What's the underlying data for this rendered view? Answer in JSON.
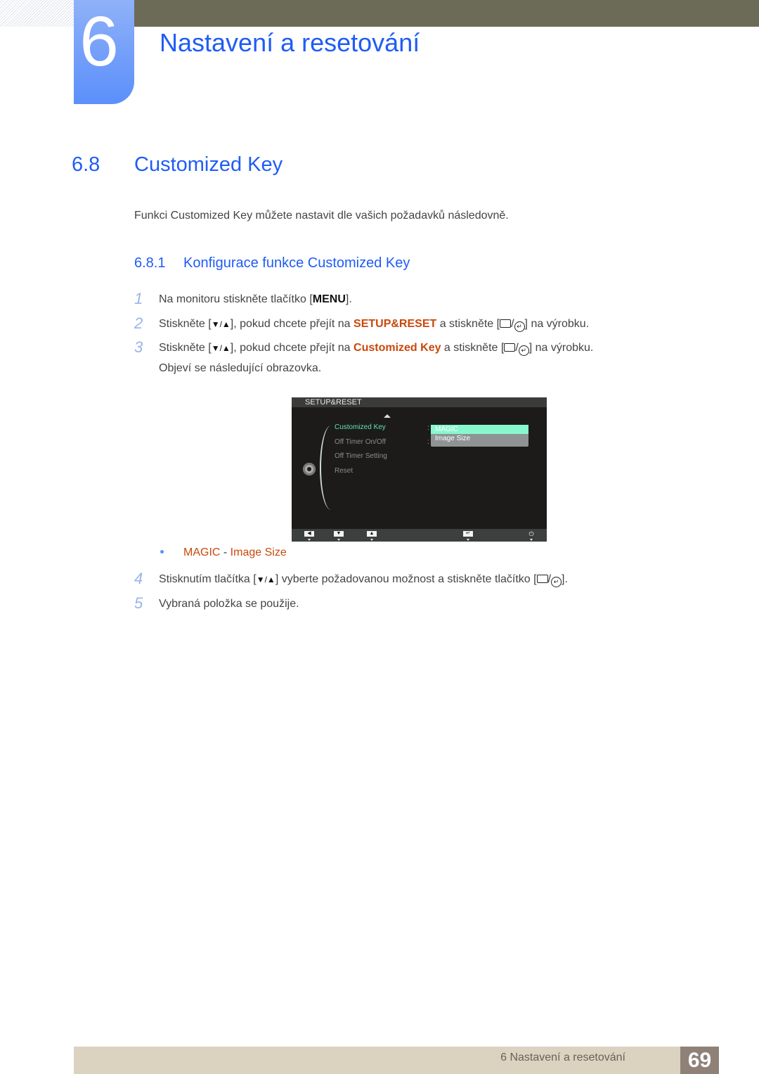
{
  "chapter": {
    "number": "6",
    "title": "Nastavení a resetování"
  },
  "section": {
    "number": "6.8",
    "title": "Customized Key"
  },
  "intro": "Funkci Customized Key můžete nastavit dle vašich požadavků následovně.",
  "subsection": {
    "number": "6.8.1",
    "title": "Konfigurace funkce Customized Key"
  },
  "steps": [
    {
      "n": "1",
      "pre": "Na monitoru stiskněte tlačítko [",
      "key": "MENU",
      "post": "]."
    },
    {
      "n": "2",
      "pre": "Stiskněte [",
      "nav": "▼/▲",
      "mid": "], pokud chcete přejít na ",
      "hl": "SETUP&RESET",
      "mid2": " a stiskněte [",
      "post": "] na výrobku."
    },
    {
      "n": "3",
      "pre": "Stiskněte [",
      "nav": "▼/▲",
      "mid": "], pokud chcete přejít na ",
      "hl": "Customized Key",
      "mid2": " a stiskněte [",
      "post": "] na výrobku.",
      "line2": "Objeví se následující obrazovka."
    },
    {
      "n": "4",
      "pre": "Stisknutím tlačítka [",
      "nav": "▼/▲",
      "mid": "] vyberte požadovanou možnost a stiskněte tlačítko [",
      "post": "]."
    },
    {
      "n": "5",
      "pre": "Vybraná položka se použije."
    }
  ],
  "osd": {
    "header": "SETUP&RESET",
    "items": [
      "Customized Key",
      "Off Timer On/Off",
      "Off Timer Setting",
      "Reset"
    ],
    "active_item": "Customized Key",
    "options": [
      "MAGIC",
      "Image Size"
    ],
    "selected_option": "MAGIC",
    "buttons": [
      "◀",
      "▼",
      "▲",
      "↵",
      "⏻"
    ]
  },
  "bullet": {
    "a": "MAGIC",
    "sep": " - ",
    "b": "Image Size"
  },
  "footer": {
    "text": "6 Nastavení a resetování",
    "page": "69"
  },
  "colors": {
    "accent": "#1f5cf5",
    "highlight": "#c9480b",
    "osd_active": "#5fe3b0"
  }
}
